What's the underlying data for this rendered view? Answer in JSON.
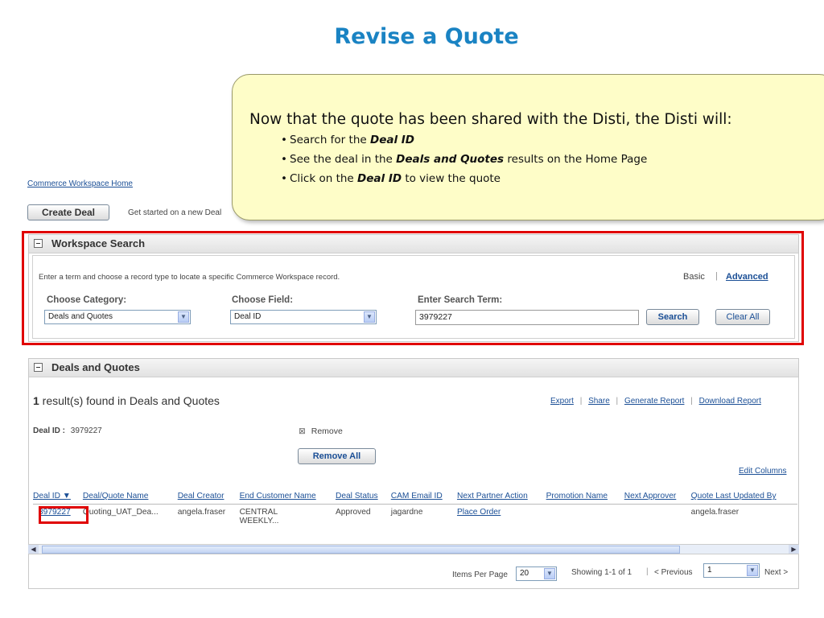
{
  "slide": {
    "title": "Revise a Quote",
    "callout": {
      "lead": "Now that the quote has been shared with the Disti, the Disti will:",
      "bullets": [
        {
          "pre": "Search for the ",
          "bold": "Deal ID",
          "post": ""
        },
        {
          "pre": "See the deal in the ",
          "bold": "Deals and Quotes",
          "post": " results on the Home Page"
        },
        {
          "pre": "Click on the ",
          "bold": "Deal ID",
          "post": " to view the quote"
        }
      ]
    }
  },
  "header": {
    "home_link": "Commerce Workspace Home",
    "create_deal_label": "Create Deal",
    "create_deal_hint": "Get started on a new Deal"
  },
  "workspace_search": {
    "title": "Workspace Search",
    "instruction": "Enter a term and choose a record type to locate a specific Commerce Workspace record.",
    "mode_basic": "Basic",
    "mode_separator": "|",
    "mode_advanced": "Advanced",
    "category_label": "Choose Category:",
    "category_value": "Deals and Quotes",
    "field_label": "Choose Field:",
    "field_value": "Deal ID",
    "term_label": "Enter Search Term:",
    "term_value": "3979227",
    "search_button": "Search",
    "clear_button": "Clear All"
  },
  "deals_quotes": {
    "title": "Deals and Quotes",
    "result_count": "1",
    "result_text": " result(s) found in Deals and Quotes",
    "actions": {
      "export": "Export",
      "share": "Share",
      "generate_report": "Generate Report",
      "download_report": "Download Report",
      "separator": "|"
    },
    "filter_label": "Deal ID :",
    "filter_value": "3979227",
    "remove_icon": "⊠",
    "remove_label": "Remove",
    "remove_all_label": "Remove All",
    "edit_columns": "Edit Columns",
    "columns": [
      "Deal ID ▼",
      "Deal/Quote Name",
      "Deal Creator",
      "End Customer Name",
      "Deal Status",
      "CAM Email ID",
      "Next Partner Action",
      "Promotion Name",
      "Next Approver",
      "Quote Last Updated By"
    ],
    "row": {
      "deal_id": "3979227",
      "name": "Quoting_UAT_Dea...",
      "creator": "angela.fraser",
      "customer_line1": "CENTRAL",
      "customer_line2": "WEEKLY...",
      "status": "Approved",
      "cam": "jagardne",
      "next_action": "Place Order",
      "promotion": "",
      "approver": "",
      "updated_by": "angela.fraser"
    },
    "pagination": {
      "items_per_page_label": "Items Per Page",
      "items_per_page_value": "20",
      "showing": "Showing 1-1 of 1",
      "previous": "< Previous",
      "page_value": "1",
      "next": "Next >"
    }
  },
  "colors": {
    "title_blue": "#1a83c3",
    "callout_bg": "#fefdc8",
    "highlight_red": "#e00000",
    "link_blue": "#1b4f96"
  }
}
